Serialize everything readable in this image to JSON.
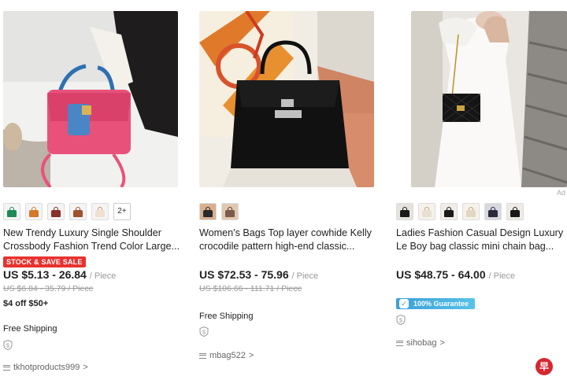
{
  "products": [
    {
      "title_line1": "New Trendy Luxury Single Shoulder",
      "title_line2": "Crossbody Fashion Trend Color Large...",
      "sale_badge": "STOCK & SAVE SALE",
      "price": "US $5.13 - 26.84",
      "unit": "/ Piece",
      "old_price": "US $6.84 - 35.79 / Piece",
      "promo": "$4 off $50+",
      "shipping": "Free Shipping",
      "store": "tkhotproducts999",
      "more_variants": "2+",
      "swatch_colors": [
        "#1f8a57",
        "#d07a2a",
        "#8a2f2a",
        "#a0522d",
        "#f0e0d0"
      ]
    },
    {
      "title_line1": "Women's Bags Top layer cowhide Kelly",
      "title_line2": "crocodile pattern high-end classic...",
      "price": "US $72.53 - 75.96",
      "unit": "/ Piece",
      "old_price": "US $106.66 - 111.71 / Piece",
      "shipping": "Free Shipping",
      "store": "mbag522",
      "swatch_colors": [
        "#2a2a2a",
        "#7a5a4a"
      ]
    },
    {
      "title_line1": "Ladies Fashion Casual Design Luxury",
      "title_line2": "Le Boy bag classic mini chain bag...",
      "price": "US $48.75 - 64.00",
      "unit": "/ Piece",
      "guarantee": "100% Guarantee",
      "store": "sihobag",
      "swatch_colors": [
        "#1a1a1a",
        "#e8e0d0",
        "#1a1a1a",
        "#e0d8c0",
        "#2a2a3a",
        "#1a1a1a"
      ]
    }
  ],
  "ad_label": "Ad",
  "store_arrow": ">",
  "logo_text": "早",
  "colors": {
    "sale_red": "#e8322f",
    "guarantee_blue": "#3aa0d8"
  }
}
